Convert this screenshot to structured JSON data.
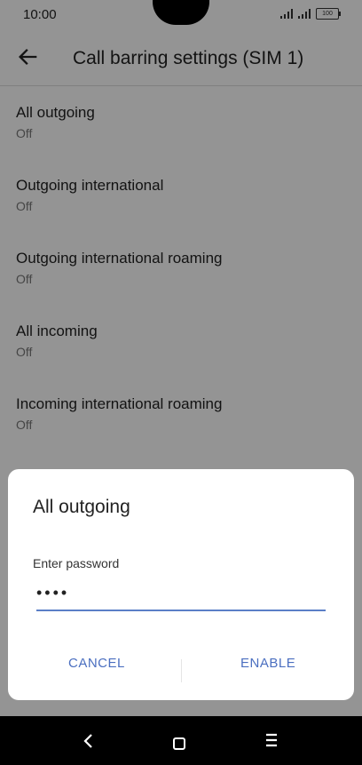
{
  "status": {
    "time": "10:00",
    "battery": "100"
  },
  "app": {
    "title": "Call barring settings (SIM 1)"
  },
  "list": [
    {
      "title": "All outgoing",
      "summary": "Off"
    },
    {
      "title": "Outgoing international",
      "summary": "Off"
    },
    {
      "title": "Outgoing international roaming",
      "summary": "Off"
    },
    {
      "title": "All incoming",
      "summary": "Off"
    },
    {
      "title": "Incoming international roaming",
      "summary": "Off"
    }
  ],
  "dialog": {
    "title": "All outgoing",
    "password_label": "Enter password",
    "password_value": "••••",
    "cancel_label": "CANCEL",
    "enable_label": "ENABLE"
  },
  "icons": {
    "back": "arrow-left-icon",
    "nav_back": "chevron-left-icon",
    "nav_home": "square-icon",
    "nav_menu": "menu-icon"
  },
  "colors": {
    "accent": "#4b6fc0",
    "scrim": "rgba(0,0,0,0.42)"
  }
}
